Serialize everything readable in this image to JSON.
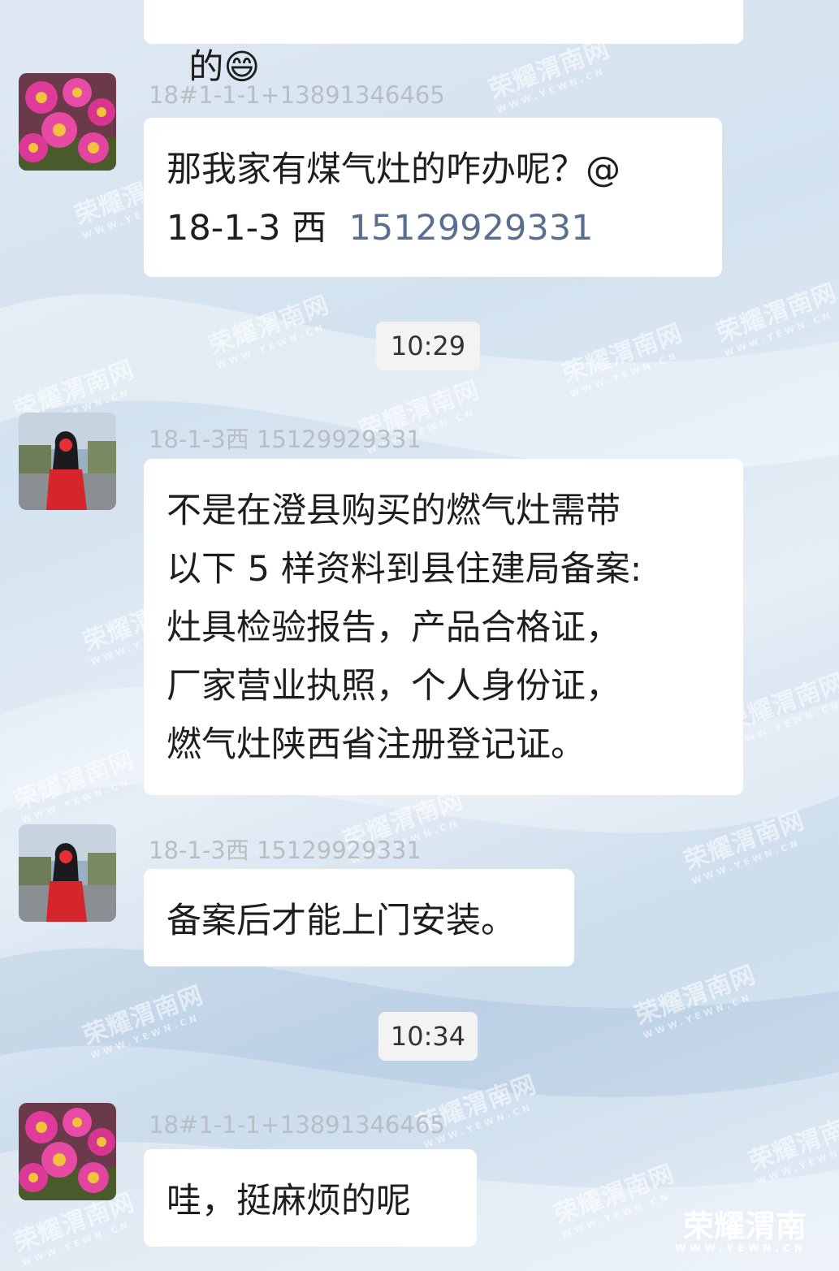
{
  "messages": [
    {
      "type": "partial",
      "text": "的😄"
    },
    {
      "type": "incoming",
      "avatar": "flower-avatar",
      "sender": "18#1-1-1+13891346465",
      "text": "那我家有煤气灶的咋办呢？@\n18-1-3 西",
      "mention": "15129929331"
    },
    {
      "type": "time",
      "text": "10:29"
    },
    {
      "type": "incoming",
      "avatar": "red-dress-avatar",
      "sender": "18-1-3西  15129929331",
      "text": "不是在澄县购买的燃气灶需带\n以下 5 样资料到县住建局备案:\n灶具检验报告，产品合格证，\n厂家营业执照，个人身份证，\n燃气灶陕西省注册登记证。"
    },
    {
      "type": "incoming",
      "avatar": "red-dress-avatar",
      "sender": "18-1-3西  15129929331",
      "text": "备案后才能上门安装。"
    },
    {
      "type": "time",
      "text": "10:34"
    },
    {
      "type": "incoming",
      "avatar": "flower-avatar",
      "sender": "18#1-1-1+13891346465",
      "text": "哇，挺麻烦的呢"
    }
  ],
  "watermark": {
    "brand": "荣耀渭南网",
    "url": "WWW.YEWN.CN"
  },
  "corner_logo": {
    "brand": "荣耀渭南",
    "url": "WWW.YEWN.CN"
  },
  "colors": {
    "bubble": "#ffffff",
    "sender": "#b8bec6",
    "mention": "#5a6f90",
    "time_pill": "#f3f3f3"
  }
}
